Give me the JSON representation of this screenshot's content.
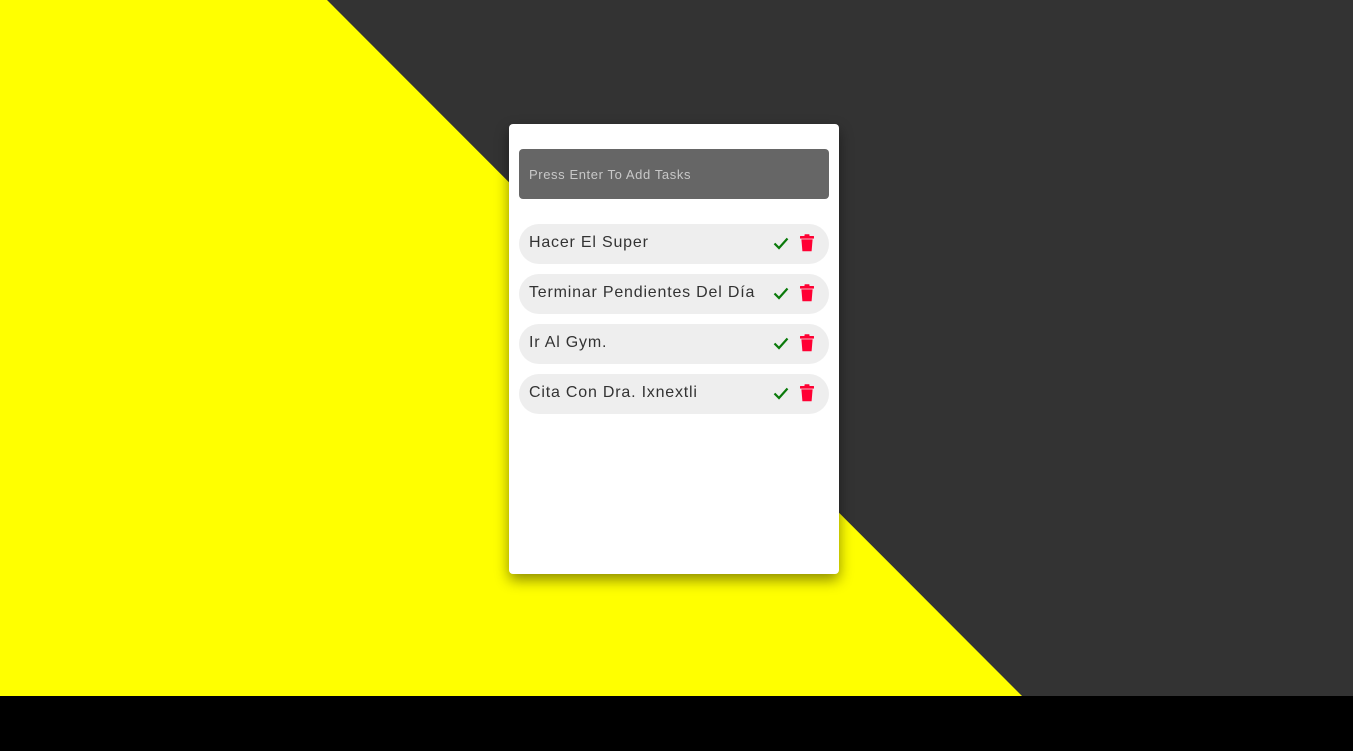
{
  "colors": {
    "background_dark": "#333333",
    "background_accent": "#ffff00",
    "input_background": "#666666",
    "task_background": "#eeeeee",
    "check_color": "#0a7a0a",
    "delete_color": "#ff0033"
  },
  "input": {
    "placeholder": "Press Enter To Add Tasks",
    "value": ""
  },
  "tasks": [
    {
      "text": "Hacer El Super",
      "complete_icon": "check-icon",
      "delete_icon": "trash-icon"
    },
    {
      "text": "Terminar Pendientes Del Día",
      "complete_icon": "check-icon",
      "delete_icon": "trash-icon"
    },
    {
      "text": "Ir Al Gym.",
      "complete_icon": "check-icon",
      "delete_icon": "trash-icon"
    },
    {
      "text": "Cita Con Dra. Ixnextli",
      "complete_icon": "check-icon",
      "delete_icon": "trash-icon"
    }
  ]
}
